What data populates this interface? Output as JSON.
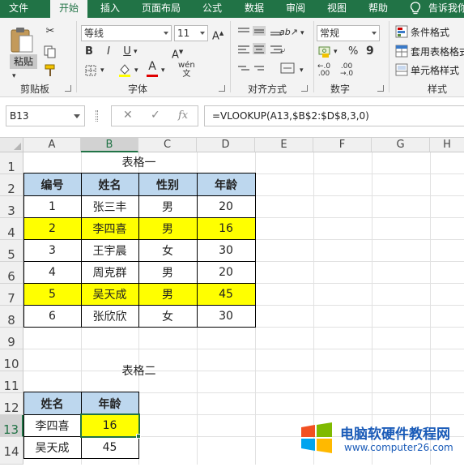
{
  "menu": {
    "tabs": [
      "文件",
      "开始",
      "插入",
      "页面布局",
      "公式",
      "数据",
      "审阅",
      "视图",
      "帮助"
    ],
    "active_tab": "开始",
    "tell_me": "告诉我你"
  },
  "ribbon": {
    "clipboard": {
      "paste": "粘贴",
      "label": "剪贴板"
    },
    "font": {
      "name": "等线",
      "size": "11",
      "label": "字体",
      "bold": "B",
      "italic": "I",
      "underline": "U",
      "color_a": "A"
    },
    "align": {
      "label": "对齐方式"
    },
    "number": {
      "format": "常规",
      "label": "数字",
      "percent": "%",
      "comma": "9"
    },
    "styles": {
      "cond": "条件格式",
      "table": "套用表格格式",
      "cell": "单元格样式",
      "label": "样式"
    }
  },
  "formula_bar": {
    "name_box": "B13",
    "fx": "fx",
    "formula": "=VLOOKUP(A13,$B$2:$D$8,3,0)"
  },
  "columns": [
    "A",
    "B",
    "C",
    "D",
    "E",
    "F",
    "G",
    "H"
  ],
  "selected_column": "B",
  "rows": [
    "1",
    "2",
    "3",
    "4",
    "5",
    "6",
    "7",
    "8",
    "9",
    "10",
    "11",
    "12",
    "13",
    "14"
  ],
  "selected_row": "13",
  "table1": {
    "title": "表格一",
    "headers": [
      "编号",
      "姓名",
      "性别",
      "年龄"
    ],
    "rows": [
      [
        "1",
        "张三丰",
        "男",
        "20"
      ],
      [
        "2",
        "李四喜",
        "男",
        "16"
      ],
      [
        "3",
        "王宇晨",
        "女",
        "30"
      ],
      [
        "4",
        "周克群",
        "男",
        "20"
      ],
      [
        "5",
        "吴天成",
        "男",
        "45"
      ],
      [
        "6",
        "张欣欣",
        "女",
        "30"
      ]
    ],
    "highlight_color": "#ffff00",
    "header_color": "#bdd7ee"
  },
  "table2": {
    "title": "表格二",
    "headers": [
      "姓名",
      "年龄"
    ],
    "rows": [
      [
        "李四喜",
        "16"
      ],
      [
        "吴天成",
        "45"
      ]
    ]
  },
  "watermark": {
    "title": "电脑软硬件教程网",
    "url": "www.computer26.com"
  },
  "colors": {
    "excel_green": "#217346",
    "header_blue": "#bdd7ee",
    "highlight": "#ffff00"
  }
}
